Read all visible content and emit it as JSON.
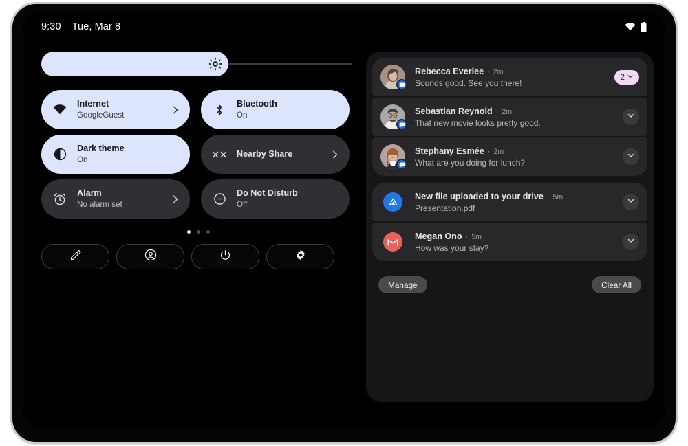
{
  "status_bar": {
    "time": "9:30",
    "date": "Tue, Mar 8",
    "icons": [
      "wifi-icon",
      "battery-icon"
    ]
  },
  "quick_settings": {
    "brightness": {
      "label": "Brightness",
      "icon": "brightness-icon",
      "value_percent": 60
    },
    "tiles": [
      {
        "label": "Internet",
        "sub": "GoogleGuest",
        "icon": "wifi-icon",
        "state": "active",
        "chevron": true
      },
      {
        "label": "Bluetooth",
        "sub": "On",
        "icon": "bluetooth-icon",
        "state": "active",
        "chevron": false
      },
      {
        "label": "Dark theme",
        "sub": "On",
        "icon": "dark-theme-icon",
        "state": "active",
        "chevron": false
      },
      {
        "label": "Nearby Share",
        "sub": "",
        "icon": "nearby-share-icon",
        "state": "inactive",
        "chevron": true
      },
      {
        "label": "Alarm",
        "sub": "No alarm set",
        "icon": "alarm-icon",
        "state": "inactive",
        "chevron": true
      },
      {
        "label": "Do Not Disturb",
        "sub": "Off",
        "icon": "do-not-disturb-icon",
        "state": "inactive",
        "chevron": false
      }
    ],
    "pages": {
      "count": 3,
      "active": 1
    },
    "footer_buttons": [
      {
        "name": "edit-tiles-button",
        "icon": "pencil-icon"
      },
      {
        "name": "user-switch-button",
        "icon": "account-circle-icon"
      },
      {
        "name": "power-button",
        "icon": "power-icon"
      },
      {
        "name": "settings-button",
        "icon": "gear-icon"
      }
    ]
  },
  "shade": {
    "groups": [
      {
        "notifications": [
          {
            "title": "Rebecca Everlee",
            "separator": "·",
            "time": "2m",
            "text": "Sounds good. See you there!",
            "avatar": "photo-avatar-rebecca",
            "avatar_color": "#9d8a82",
            "app_badge": "messages-icon",
            "trailing": "count-badge",
            "count": "2"
          },
          {
            "title": "Sebastian Reynold",
            "separator": "·",
            "time": "2m",
            "text": "That new movie looks pretty good.",
            "avatar": "photo-avatar-sebastian",
            "avatar_color": "#a9a9a9",
            "app_badge": "messages-icon",
            "trailing": "expand-button"
          },
          {
            "title": "Stephany Esmée",
            "separator": "·",
            "time": "2m",
            "text": "What are you doing for lunch?",
            "avatar": "photo-avatar-stephany",
            "avatar_color": "#b59a9a",
            "app_badge": "messages-icon",
            "trailing": "expand-button"
          }
        ]
      },
      {
        "notifications": [
          {
            "title": "New file uploaded to your drive",
            "separator": "·",
            "time": "5m",
            "text": "Presentation.pdf",
            "avatar": "drive-app-icon",
            "app_badge": "",
            "trailing": "expand-button"
          },
          {
            "title": "Megan Ono",
            "separator": "·",
            "time": "5m",
            "text": "How was your stay?",
            "avatar": "gmail-app-icon",
            "app_badge": "",
            "trailing": "expand-button"
          }
        ]
      }
    ],
    "manage_label": "Manage",
    "clear_all_label": "Clear All"
  },
  "colors": {
    "tile_active_bg": "#dde5fc",
    "tile_inactive_bg": "#2f3033",
    "shade_bg": "#161618",
    "notification_bg": "#28282b",
    "badge_pink": "#f2d9f4",
    "drive_blue": "#2176e8",
    "gmail_red": "#e8625c",
    "messages_blue": "#1b6ef3"
  }
}
